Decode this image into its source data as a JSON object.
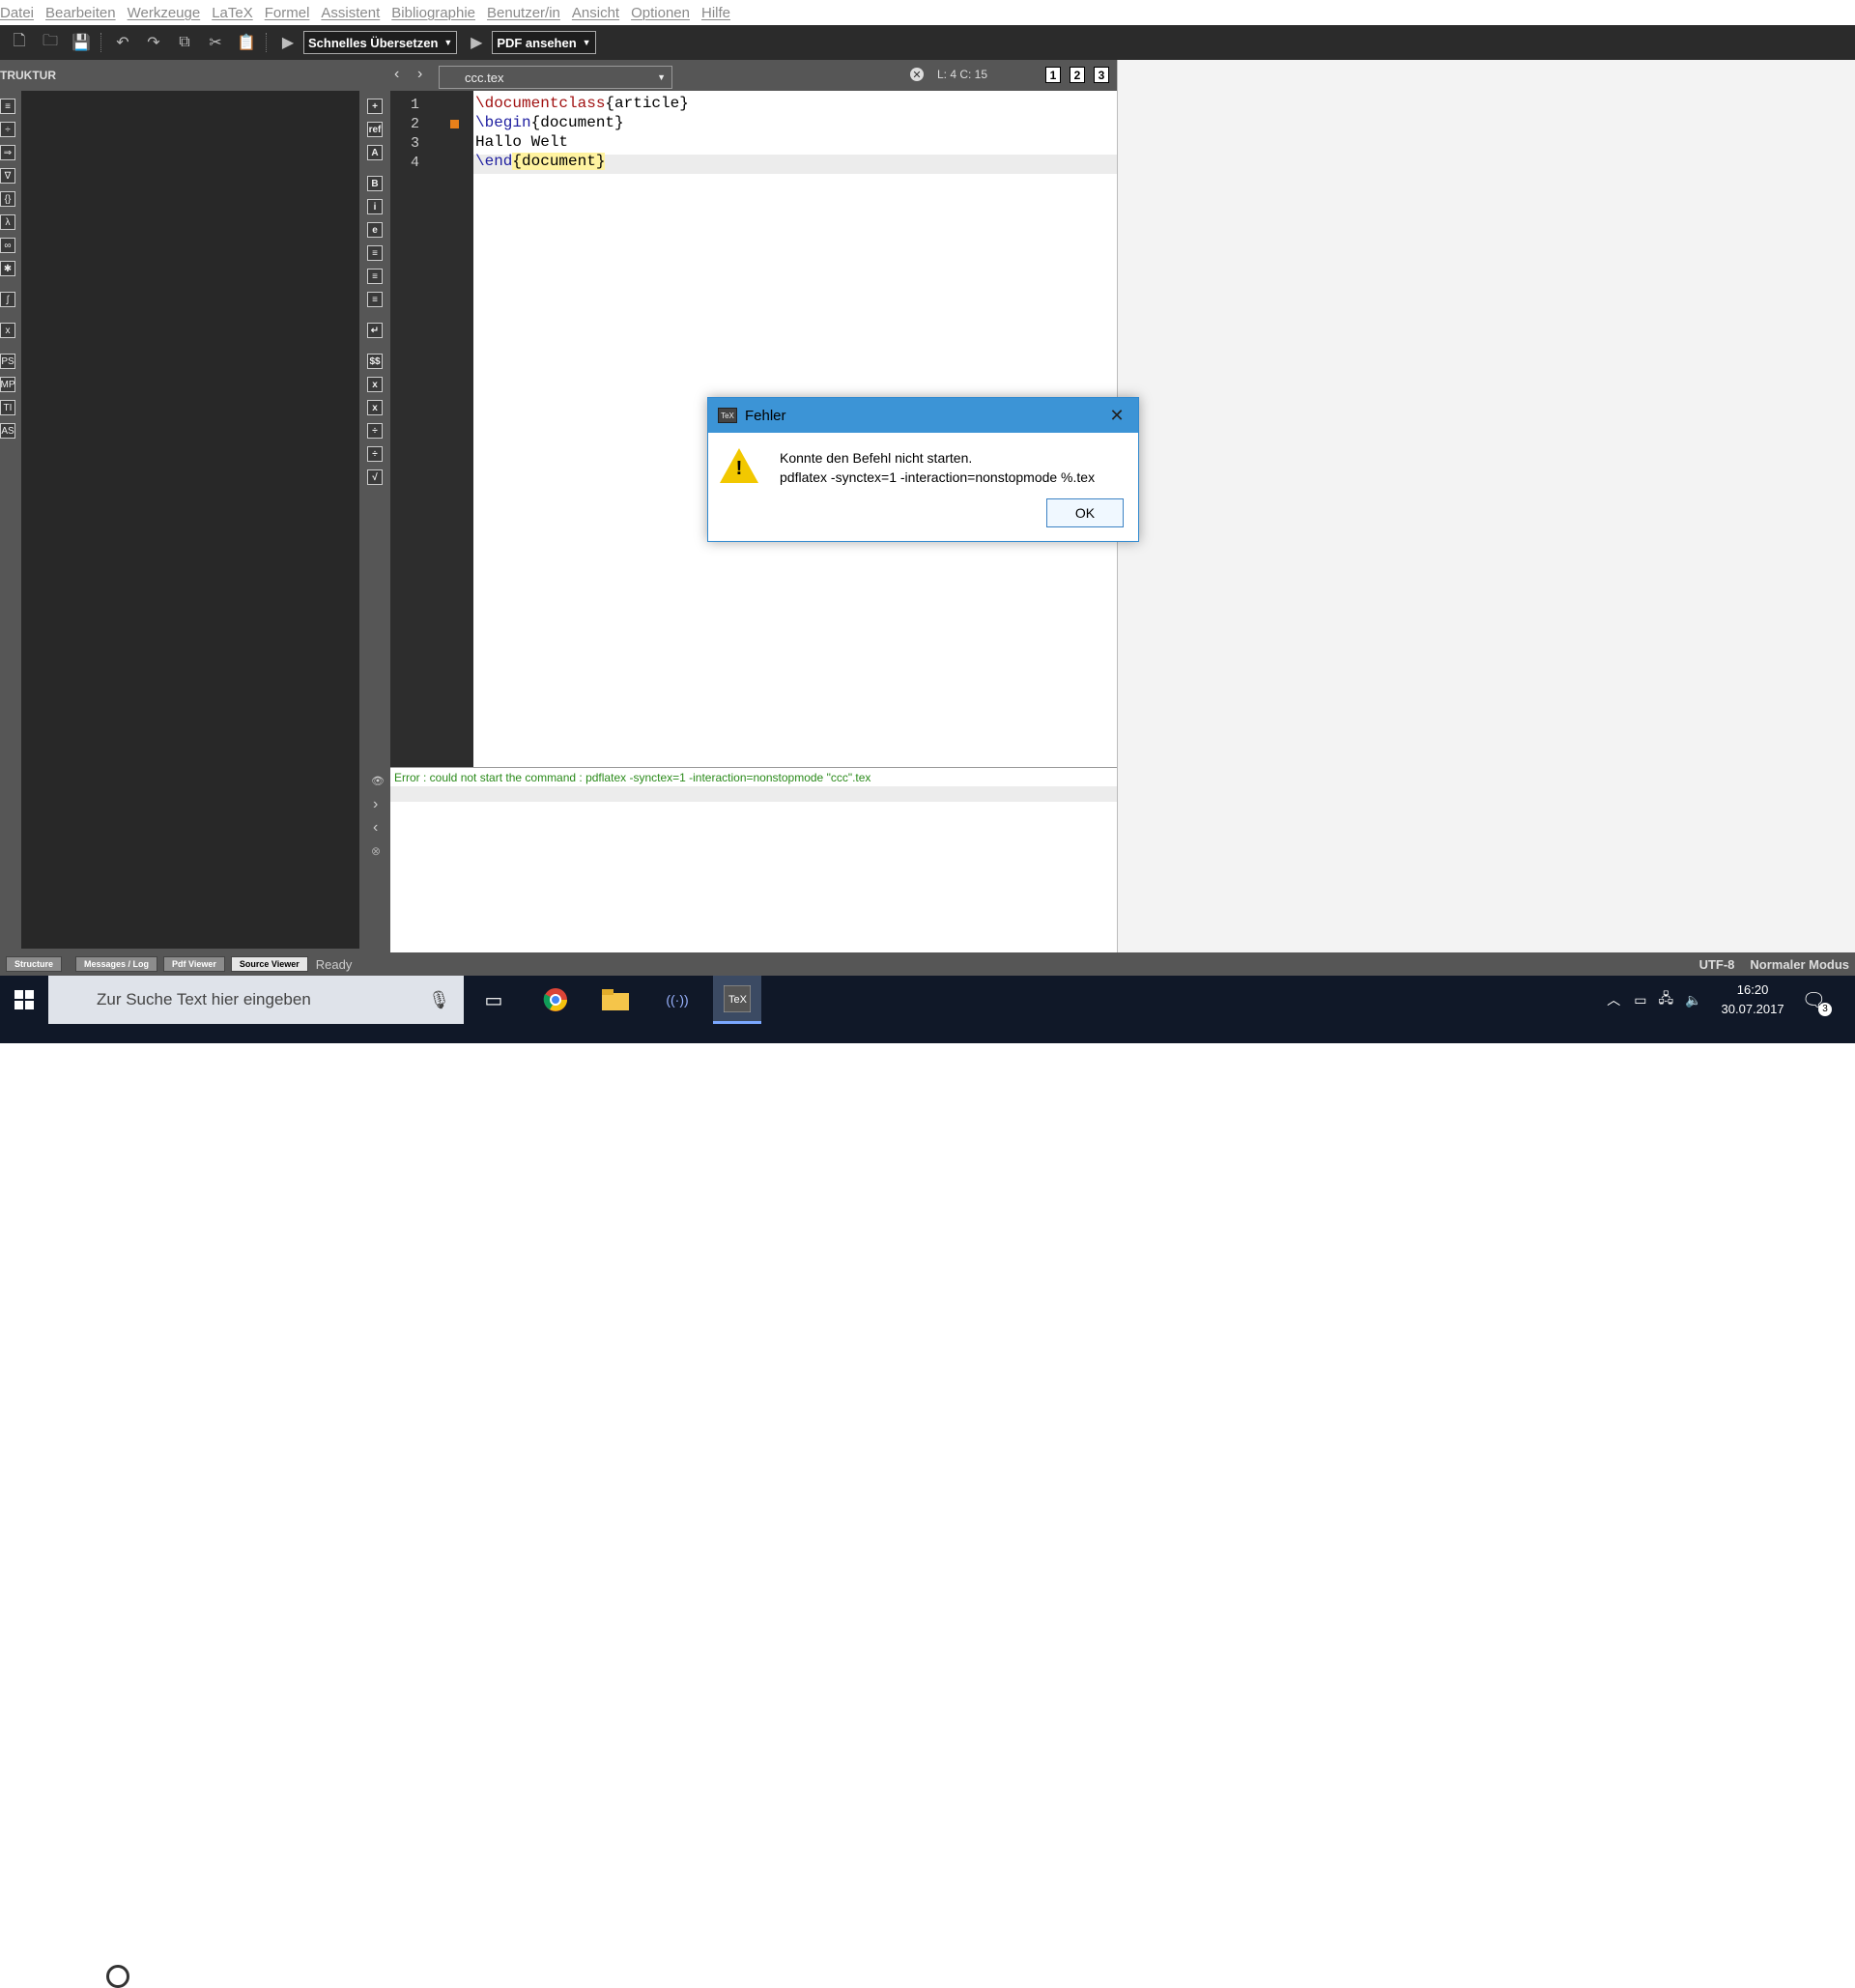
{
  "menu": {
    "items": [
      "Datei",
      "Bearbeiten",
      "Werkzeuge",
      "LaTeX",
      "Formel",
      "Assistent",
      "Bibliographie",
      "Benutzer/in",
      "Ansicht",
      "Optionen",
      "Hilfe"
    ]
  },
  "toolbar": {
    "quick_build": "Schnelles Übersetzen",
    "view_pdf": "PDF ansehen"
  },
  "structure": {
    "title": "TRUKTUR",
    "icons": [
      "≡",
      "÷",
      "⇒",
      "∇",
      "{}",
      "λ",
      "∞",
      "✱",
      "∫",
      "x",
      "PS",
      "MP",
      "TI",
      "AS"
    ]
  },
  "dock": {
    "icons": [
      "+",
      "ref",
      "A",
      "B",
      "i",
      "e",
      "≡",
      "≡",
      "≡",
      "↵",
      "$$",
      "x",
      "x",
      "÷",
      "÷",
      "√"
    ]
  },
  "editor": {
    "tab": "ccc.tex",
    "cursor": "L: 4 C: 15",
    "views": [
      "1",
      "2",
      "3"
    ],
    "lines": [
      {
        "num": "1",
        "cmd": "\\documentclass",
        "arg": "{article}"
      },
      {
        "num": "2",
        "cmd": "\\begin",
        "arg": "{document}"
      },
      {
        "num": "3",
        "cmd": "",
        "arg": "Hallo Welt"
      },
      {
        "num": "4",
        "cmd": "\\end",
        "arg": "{document}"
      }
    ]
  },
  "messages": {
    "error": "Error : could not start the command : pdflatex -synctex=1 -interaction=nonstopmode \"ccc\".tex"
  },
  "statusbar": {
    "tabs": [
      "Structure",
      "Messages / Log",
      "Pdf Viewer",
      "Source Viewer"
    ],
    "ready": "Ready",
    "encoding": "UTF-8",
    "mode": "Normaler Modus"
  },
  "dialog": {
    "title": "Fehler",
    "message1": "Konnte den Befehl nicht starten.",
    "message2": "pdflatex -synctex=1 -interaction=nonstopmode %.tex",
    "ok": "OK",
    "warning_glyph": "!"
  },
  "taskbar": {
    "search_placeholder": "Zur Suche Text hier eingeben",
    "time": "16:20",
    "date": "30.07.2017",
    "notifications": "3"
  },
  "colors": {
    "toolbar_bg": "#2b2b2b",
    "panel_bg": "#565656",
    "dialog_title": "#3c94d6",
    "error_text": "#2a8a1a",
    "taskbar": "#101828"
  }
}
